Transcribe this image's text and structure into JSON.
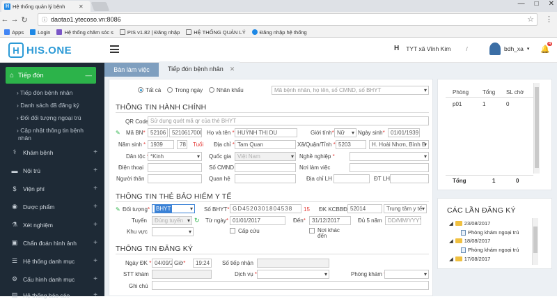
{
  "browser": {
    "tab_title": "Hệ thống quản lý bệnh",
    "tab_icon": "H",
    "url": "daotao1.ytecoso.vn:8086",
    "window_controls": [
      "—",
      "□",
      "✕"
    ],
    "bookmarks": [
      {
        "label": "Apps",
        "color": "#4285f4"
      },
      {
        "label": "Login",
        "color": "#1e88e5"
      },
      {
        "label": "Hệ thống chăm sóc s",
        "color": "#7a56c7"
      },
      {
        "label": "PIS v1.82 | Đăng nhập",
        "color": "#555555"
      },
      {
        "label": "HỆ THỐNG QUẢN LÝ",
        "color": "#555555"
      },
      {
        "label": "Đăng nhập hệ thống",
        "color": "#1e88e5"
      }
    ]
  },
  "header": {
    "logo_text": "HIS.ONE",
    "logo_mark": "H",
    "facility_icon": "H",
    "facility": "TYT xã Vĩnh Kim",
    "separator": "/",
    "username": "bdh_xa",
    "notification_count": "4"
  },
  "sidebar": {
    "active": "Tiếp đón",
    "sub_items": [
      "Tiếp đón bệnh nhân",
      "Danh sách đã đăng ký",
      "Đối đối tượng ngoại trú",
      "Cập nhật thông tin bệnh",
      "nhân"
    ],
    "items": [
      {
        "label": "Khám bệnh",
        "icon": "stethoscope-icon",
        "glyph": "⚕"
      },
      {
        "label": "Nội trú",
        "icon": "bed-icon",
        "glyph": "▬"
      },
      {
        "label": "Viện phí",
        "icon": "dollar-icon",
        "glyph": "$"
      },
      {
        "label": "Dược phẩm",
        "icon": "pill-icon",
        "glyph": "◉"
      },
      {
        "label": "Xét nghiệm",
        "icon": "flask-icon",
        "glyph": "⚗"
      },
      {
        "label": "Chẩn đoán hình ảnh",
        "icon": "image-icon",
        "glyph": "▣"
      },
      {
        "label": "Hệ thống danh mục",
        "icon": "list-icon",
        "glyph": "☰"
      },
      {
        "label": "Cấu hình danh mục",
        "icon": "gear-icon",
        "glyph": "⚙"
      },
      {
        "label": "Hệ thống báo cáo",
        "icon": "report-icon",
        "glyph": "▤"
      }
    ]
  },
  "tabs": {
    "tab1": "Bàn làm việc",
    "tab2": "Tiếp đón bệnh nhân",
    "tab2_close": "✕"
  },
  "filters": {
    "all": "Tất cả",
    "today": "Trong ngày",
    "staff": "Nhân khẩu",
    "search_placeholder": "Mã bệnh nhân, họ tên, số CMND, số BHYT"
  },
  "admin": {
    "title": "THÔNG TIN HÀNH CHÍNH",
    "qr_label": "QR Code",
    "qr_placeholder": "Sử dụng quét mã qr của thẻ BHYT",
    "mabn_label": "Mã BN",
    "mabn1": "52106",
    "mabn2": "5210617000",
    "hoten_label": "Họ và tên",
    "hoten": "HUỲNH THỊ DU",
    "gioitinh_label": "Giới tính",
    "gioitinh": "Nữ",
    "ngaysinh_label": "Ngày sinh",
    "ngaysinh": "01/01/1939",
    "namsinh_label": "Năm sinh",
    "namsinh": "1939",
    "tuoi_val": "78",
    "tuoi_label": "Tuổi",
    "diachi_label": "Địa chỉ",
    "diachi": "Tam Quan",
    "xa_label": "Xã/Quận/Tỉnh",
    "xa_code": "5203",
    "xa": "H. Hoài Nhơn, Bình Đ",
    "dantoc_label": "Dân tộc",
    "dantoc": "*Kinh",
    "quocgia_label": "Quốc gia",
    "quocgia": "Việt Nam",
    "nghenghiep_label": "Nghề nghiệp",
    "dienthoai_label": "Điện thoại",
    "cmnd_label": "Số CMND",
    "noilamviec_label": "Nơi làm việc",
    "nguoithan_label": "Người thân",
    "quanhe_label": "Quan hệ",
    "diachilh_label": "Địa chỉ LH",
    "dtlh_label": "ĐT LH"
  },
  "insurance": {
    "title": "THÔNG TIN THẺ BẢO HIỂM Y TẾ",
    "doituong_label": "Đối tượng",
    "doituong": "BHYT",
    "sobhyt_label": "Số BHYT",
    "sobhyt": "GD4520301804538",
    "sobhyt_len": "15",
    "dkkcbbd_label": "ĐK KCBBĐ",
    "dkkcbbd": "52014",
    "dkkcbbd_name": "Trung tâm y tế",
    "tuyen_label": "Tuyến",
    "tuyen": "Đúng tuyến",
    "tungay_label": "Từ ngày",
    "tungay": "01/01/2017",
    "den_label": "Đến",
    "den": "31/12/2017",
    "du5nam_label": "Đủ 5 năm",
    "du5nam_placeholder": "DD/MM/YYYY",
    "khuvuc_label": "Khu vực",
    "capcuu_label": "Cấp cứu",
    "noikhac_label": "Nơi khác",
    "noikhac_label2": "đến"
  },
  "register": {
    "title": "THÔNG TIN ĐĂNG KÝ",
    "ngaydk_label": "Ngày ĐK",
    "ngaydk": "04/09/2",
    "gio_label": "Giờ",
    "gio": "19:24",
    "sotiepnhan_label": "Số tiếp nhận",
    "stthang_label": "STT khám",
    "dichvu_label": "Dịch vụ",
    "phongkham_label": "Phòng khám",
    "ghichu_label": "Ghi chú"
  },
  "room_table": {
    "headers": [
      "Phòng",
      "Tổng",
      "SL chờ"
    ],
    "rows": [
      [
        "p01",
        "1",
        "0"
      ]
    ],
    "total_label": "Tổng",
    "total_sum": "1",
    "total_wait": "0"
  },
  "visits": {
    "title": "CÁC LẦN ĐĂNG KÝ",
    "items": [
      {
        "date": "23/08/2017",
        "room": "Phòng khám ngoại trú"
      },
      {
        "date": "18/08/2017",
        "room": "Phòng khám ngoại trú"
      },
      {
        "date": "17/08/2017",
        "room": ""
      }
    ]
  }
}
